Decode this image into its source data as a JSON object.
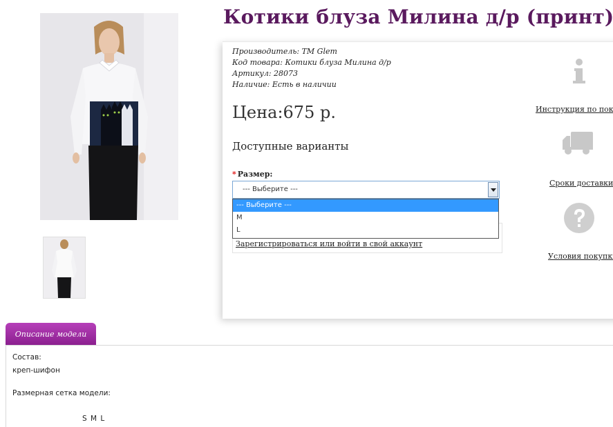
{
  "product": {
    "title": "Котики блуза Милина д/р (принт)",
    "manufacturer_label": "Производитель:",
    "manufacturer": "ТМ Glem",
    "code_label": "Код товара:",
    "code": "Котики блуза Милина д/р",
    "article_label": "Артикул:",
    "article": "28073",
    "stock_label": "Наличие:",
    "stock": "Есть в наличии",
    "price": "Цена:675 р.",
    "variants_heading": "Доступные варианты"
  },
  "size": {
    "required_mark": "*",
    "label": "Размер:",
    "selected": "--- Выберите ---",
    "options": [
      "--- Выберите ---",
      "M",
      "L"
    ]
  },
  "account": {
    "login_link": "Зарегистрироваться или войти в свой аккаунт"
  },
  "sidebar": {
    "instructions": "Инструкция по покупке",
    "delivery": "Сроки доставки",
    "terms": "Условия покупки"
  },
  "tabs": {
    "description_tab": "Описание модели"
  },
  "description": {
    "composition_label": "Состав:",
    "composition": "креп-шифон",
    "size_chart_label": "Размерная сетка модели:",
    "size_chart_sizes": "S  M  L"
  },
  "colors": {
    "title": "#5a1a5e",
    "tab": "#a030a4",
    "dropdown_highlight": "#3399ff",
    "required": "#e01010"
  }
}
